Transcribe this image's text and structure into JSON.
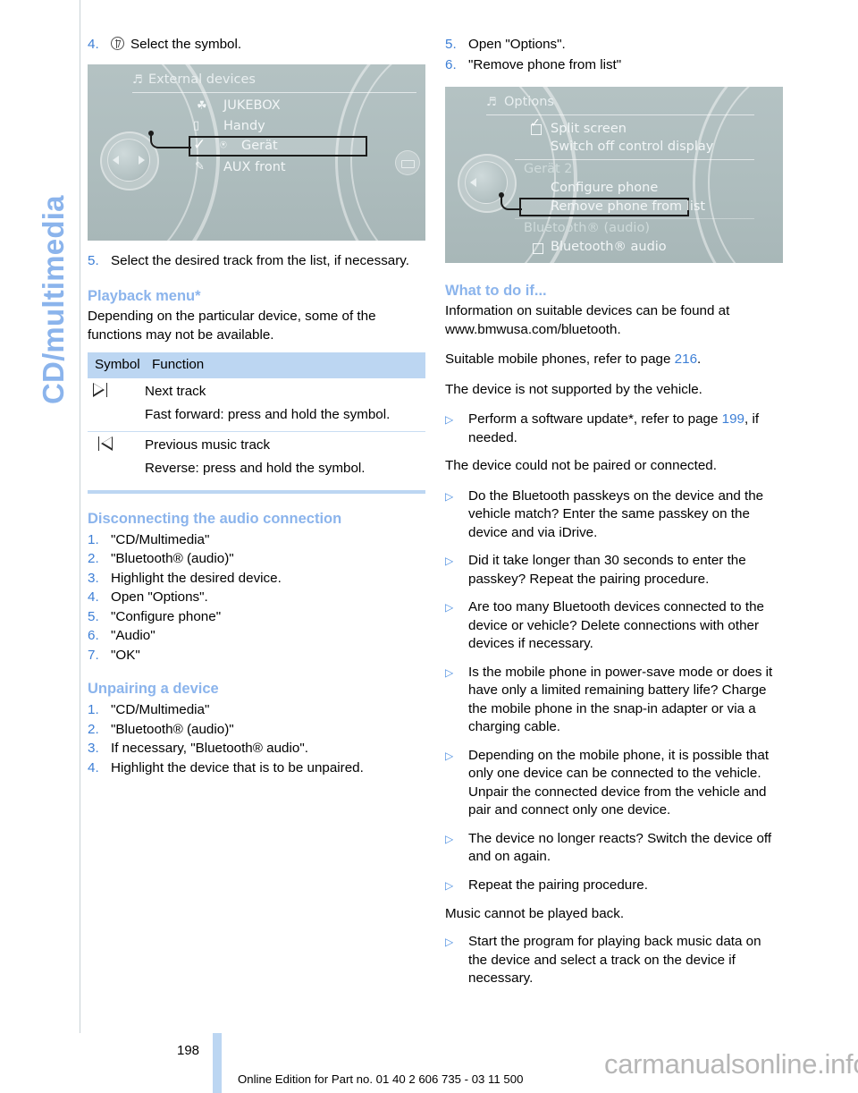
{
  "chapter": {
    "tab_label": "CD/multimedia"
  },
  "left_column": {
    "step4": {
      "number": "4.",
      "icon": "bluetooth-icon",
      "text": "Select the symbol."
    },
    "figure_external_devices": {
      "title": "External devices",
      "header_icon": "multimedia-icon",
      "items": [
        {
          "icon": "usb-icon",
          "label": "JUKEBOX",
          "selected": false,
          "checked": false
        },
        {
          "icon": "snap-in-adapter-icon",
          "label": "Handy",
          "selected": false,
          "checked": false
        },
        {
          "icon": "bluetooth-icon",
          "label": "Gerät",
          "selected": true,
          "checked": true
        },
        {
          "icon": "aux-pen-icon",
          "label": "AUX front",
          "selected": false,
          "checked": false
        }
      ]
    },
    "step5": {
      "number": "5.",
      "text": "Select the desired track from the list, if necessary."
    },
    "playback_heading": "Playback menu*",
    "playback_intro": "Depending on the particular device, some of the functions may not be available.",
    "table": {
      "headers": [
        "Symbol",
        "Function"
      ],
      "rows": [
        {
          "symbol": "next-track-icon",
          "lines": [
            "Next track",
            "Fast forward: press and hold the symbol."
          ]
        },
        {
          "symbol": "previous-track-icon",
          "lines": [
            "Previous music track",
            "Reverse: press and hold the symbol."
          ]
        }
      ]
    },
    "disconnect_heading": "Disconnecting the audio connection",
    "disconnect_steps": [
      "\"CD/Multimedia\"",
      "\"Bluetooth® (audio)\"",
      "Highlight the desired device.",
      "Open \"Options\".",
      "\"Configure phone\"",
      "\"Audio\"",
      "\"OK\""
    ],
    "unpair_heading": "Unpairing a device",
    "unpair_steps": [
      "\"CD/Multimedia\"",
      "\"Bluetooth® (audio)\"",
      "If necessary, \"Bluetooth® audio\".",
      "Highlight the device that is to be unpaired."
    ]
  },
  "right_column": {
    "step5": {
      "number": "5.",
      "text": "Open \"Options\"."
    },
    "step6": {
      "number": "6.",
      "text": "\"Remove phone from list\""
    },
    "figure_options": {
      "title": "Options",
      "header_icon": "multimedia-icon",
      "items": [
        {
          "label": "Split screen",
          "checkbox": "checked",
          "style": "normal",
          "selected": false
        },
        {
          "label": "Switch off control display",
          "checkbox": "none",
          "style": "normal",
          "selected": false
        },
        {
          "label": "Gerät 2",
          "checkbox": "none",
          "style": "dim",
          "selected": false
        },
        {
          "label": "Configure phone",
          "checkbox": "none",
          "style": "normal",
          "selected": false
        },
        {
          "label": "Remove phone from list",
          "checkbox": "none",
          "style": "normal",
          "selected": true
        },
        {
          "label": "Bluetooth® (audio)",
          "checkbox": "none",
          "style": "dim",
          "selected": false
        },
        {
          "label": "Bluetooth® audio",
          "checkbox": "unchecked",
          "style": "normal",
          "selected": false
        }
      ]
    },
    "what_heading": "What to do if...",
    "para_info": "Information on suitable devices can be found at www.bmwusa.com/bluetooth.",
    "para_suitable_pre": "Suitable mobile phones, refer to page ",
    "para_suitable_page": "216",
    "para_suitable_post": ".",
    "para_not_supported": "The device is not supported by the vehicle.",
    "bullet_software_pre": "Perform a software update*, refer to page ",
    "bullet_software_page": "199",
    "bullet_software_post": ", if needed.",
    "para_not_paired": "The device could not be paired or connected.",
    "bullets": [
      "Do the Bluetooth passkeys on the device and the vehicle match? Enter the same passkey on the device and via iDrive.",
      "Did it take longer than 30 seconds to enter the passkey? Repeat the pairing procedure.",
      "Are too many Bluetooth devices connected to the device or vehicle? Delete connections with other devices if necessary.",
      "Is the mobile phone in power-save mode or does it have only a limited remaining battery life? Charge the mobile phone in the snap-in adapter or via a charging cable.",
      "Depending on the mobile phone, it is possible that only one device can be connected to the vehicle. Unpair the connected device from the vehicle and pair and connect only one device.",
      "The device no longer reacts? Switch the device off and on again.",
      "Repeat the pairing procedure."
    ],
    "para_music": "Music cannot be played back.",
    "bullet_music": "Start the program for playing back music data on the device and select a track on the device if necessary."
  },
  "footer": {
    "page_number": "198",
    "edition": "Online Edition for Part no. 01 40 2 606 735 - 03 11 500",
    "watermark": "carmanualsonline.info"
  },
  "colors": {
    "heading_blue": "#8bb4ec",
    "number_blue": "#3d7fd6",
    "table_header": "#bcd6f2",
    "screen_gray": "#aebdbe"
  }
}
